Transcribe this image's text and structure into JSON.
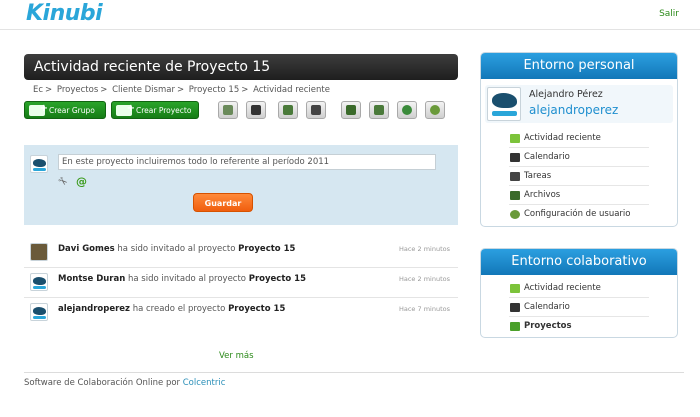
{
  "header": {
    "logo": "Kinubi",
    "logout_label": "Salir"
  },
  "main": {
    "title": "Actividad reciente de Proyecto 15",
    "breadcrumb": [
      "Ec",
      "Proyectos",
      "Cliente Dismar",
      "Proyecto 15",
      "Actividad reciente"
    ],
    "create_group_label": "Crear Grupo",
    "create_project_label": "Crear Proyecto",
    "toolbar_icons": [
      "tasks-icon",
      "calendar-icon",
      "comments-icon",
      "notes-icon",
      "files-icon",
      "folder-icon",
      "users-icon",
      "settings-icon"
    ],
    "composer": {
      "placeholder": "En este proyecto incluiremos todo lo referente al período 2011",
      "save_label": "Guardar"
    },
    "activities": [
      {
        "user": "Davi Gomes",
        "action": "ha sido invitado al proyecto",
        "project": "Proyecto 15",
        "time": "Hace 2 minutos"
      },
      {
        "user": "Montse Duran",
        "action": "ha sido invitado al proyecto",
        "project": "Proyecto 15",
        "time": "Hace 2 minutos"
      },
      {
        "user": "alejandroperez",
        "action": "ha creado el proyecto",
        "project": "Proyecto 15",
        "time": "Hace 7 minutos"
      }
    ],
    "more_label": "Ver más"
  },
  "personal": {
    "title": "Entorno personal",
    "user_name": "Alejandro Pérez",
    "user_login": "alejandroperez",
    "items": [
      "Actividad reciente",
      "Calendario",
      "Tareas",
      "Archivos",
      "Configuración de usuario"
    ]
  },
  "collab": {
    "title": "Entorno colaborativo",
    "items": [
      "Actividad reciente",
      "Calendario",
      "Proyectos"
    ]
  },
  "footer": {
    "text": "Software de Colaboración Online por",
    "brand": "Colcentric"
  },
  "colors": {
    "brand_blue": "#2aa6d9",
    "green": "#2c8a1a",
    "orange": "#f05e0e",
    "panel_blue": "#1f8fcf"
  }
}
